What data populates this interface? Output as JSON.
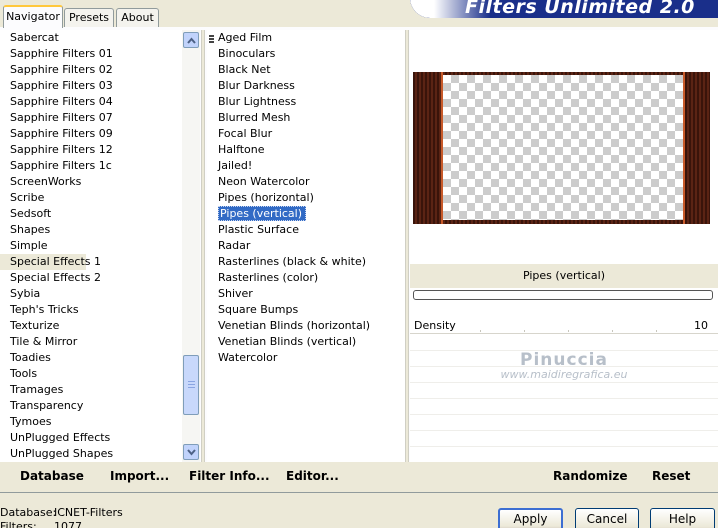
{
  "app": {
    "title": "Filters Unlimited 2.0"
  },
  "tabs": [
    {
      "label": "Navigator",
      "active": true
    },
    {
      "label": "Presets",
      "active": false
    },
    {
      "label": "About",
      "active": false
    }
  ],
  "categories": {
    "items": [
      "Sabercat",
      "Sapphire Filters 01",
      "Sapphire Filters 02",
      "Sapphire Filters 03",
      "Sapphire Filters 04",
      "Sapphire Filters 07",
      "Sapphire Filters 09",
      "Sapphire Filters 12",
      "Sapphire Filters 1c",
      "ScreenWorks",
      "Scribe",
      "Sedsoft",
      "Shapes",
      "Simple",
      "Special Effects 1",
      "Special Effects 2",
      "Sybia",
      "Teph's Tricks",
      "Texturize",
      "Tile & Mirror",
      "Toadies",
      "Tools",
      "Tramages",
      "Transparency",
      "Tymoes",
      "UnPlugged Effects",
      "UnPlugged Shapes"
    ],
    "selected": "Special Effects 1"
  },
  "filters": {
    "items": [
      "Aged Film",
      "Binoculars",
      "Black Net",
      "Blur Darkness",
      "Blur Lightness",
      "Blurred Mesh",
      "Focal Blur",
      "Halftone",
      "Jailed!",
      "Neon Watercolor",
      "Pipes (horizontal)",
      "Pipes (vertical)",
      "Plastic Surface",
      "Radar",
      "Rasterlines (black & white)",
      "Rasterlines (color)",
      "Shiver",
      "Square Bumps",
      "Venetian Blinds (horizontal)",
      "Venetian Blinds (vertical)",
      "Watercolor"
    ],
    "selected": "Pipes (vertical)"
  },
  "preview": {
    "filter_name": "Pipes (vertical)"
  },
  "parameters": [
    {
      "name": "Density",
      "value": "10"
    }
  ],
  "watermark": {
    "name": "Pinuccia",
    "url": "www.maidiregrafica.eu"
  },
  "actions": {
    "database": "Database",
    "import": "Import...",
    "filter_info": "Filter Info...",
    "editor": "Editor...",
    "randomize": "Randomize",
    "reset": "Reset"
  },
  "status": {
    "database_label": "Database:",
    "database_value": "ICNET-Filters",
    "filters_label": "Filters:",
    "filters_value": "1077"
  },
  "buttons": {
    "apply": "Apply",
    "cancel": "Cancel",
    "help": "Help"
  },
  "colors": {
    "selection": "#316ac5",
    "banner": "#1a2f8a",
    "tab_highlight": "#ffc83c"
  }
}
